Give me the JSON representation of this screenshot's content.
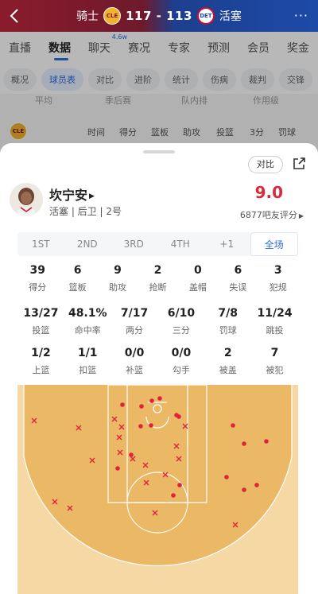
{
  "header": {
    "home_team": "骑士",
    "home_logo": "CLE",
    "score": "117 - 113",
    "away_logo": "DET",
    "away_team": "活塞"
  },
  "tabs": [
    {
      "label": "直播"
    },
    {
      "label": "数据",
      "active": true
    },
    {
      "label": "聊天",
      "badge": "4.6w"
    },
    {
      "label": "赛况"
    },
    {
      "label": "专家"
    },
    {
      "label": "预测"
    },
    {
      "label": "会员"
    },
    {
      "label": "奖金"
    }
  ],
  "subtabs": [
    {
      "label": "概况"
    },
    {
      "label": "球员表",
      "active": true
    },
    {
      "label": "对比"
    },
    {
      "label": "进阶"
    },
    {
      "label": "统计"
    },
    {
      "label": "伤病"
    },
    {
      "label": "裁判"
    },
    {
      "label": "交锋"
    }
  ],
  "background": {
    "ghost_row": [
      "平均",
      "季后赛",
      "队内排",
      "作用级"
    ],
    "team_logo": "CLE",
    "columns": [
      "时间",
      "得分",
      "篮板",
      "助攻",
      "投篮",
      "3分",
      "罚球"
    ]
  },
  "sheet": {
    "compare_label": "对比",
    "player": {
      "name": "坎宁安",
      "team_info": "活塞 | 后卫 | 2号",
      "rating": "9.0",
      "rating_label": "6877吧友评分"
    },
    "periods": [
      {
        "label": "1ST"
      },
      {
        "label": "2ND"
      },
      {
        "label": "3RD"
      },
      {
        "label": "4TH"
      },
      {
        "label": "+1"
      },
      {
        "label": "全场",
        "active": true
      }
    ],
    "stats_row1": [
      {
        "value": "39",
        "label": "得分"
      },
      {
        "value": "6",
        "label": "篮板"
      },
      {
        "value": "9",
        "label": "助攻"
      },
      {
        "value": "2",
        "label": "抢断"
      },
      {
        "value": "0",
        "label": "盖帽"
      },
      {
        "value": "6",
        "label": "失误"
      },
      {
        "value": "3",
        "label": "犯规"
      }
    ],
    "stats_row2": [
      {
        "value": "13/27",
        "label": "投篮"
      },
      {
        "value": "48.1%",
        "label": "命中率"
      },
      {
        "value": "7/17",
        "label": "两分"
      },
      {
        "value": "6/10",
        "label": "三分"
      },
      {
        "value": "7/8",
        "label": "罚球"
      },
      {
        "value": "11/24",
        "label": "跳投"
      }
    ],
    "stats_row3": [
      {
        "value": "1/2",
        "label": "上篮"
      },
      {
        "value": "1/1",
        "label": "扣篮"
      },
      {
        "value": "0/0",
        "label": "补篮"
      },
      {
        "value": "0/0",
        "label": "勾手"
      },
      {
        "value": "2",
        "label": "被盖"
      },
      {
        "value": "7",
        "label": "被犯"
      }
    ]
  },
  "colors": {
    "accent": "#2b6de5",
    "rating": "#d92b3a",
    "court_paint": "#ebb865",
    "court_outer": "#f6d8a4",
    "shot_mark": "#e0223a"
  },
  "shot_chart": {
    "made": [
      [
        24,
        8
      ],
      [
        -21,
        22
      ],
      [
        -8,
        21
      ],
      [
        -20,
        -3
      ],
      [
        -7,
        -10
      ],
      [
        95,
        21
      ],
      [
        27,
        10
      ],
      [
        -44,
        -5
      ],
      [
        3,
        -13
      ],
      [
        137,
        41
      ],
      [
        109,
        44
      ],
      [
        -33,
        58
      ],
      [
        -50,
        75
      ],
      [
        28,
        96
      ],
      [
        20,
        109
      ],
      [
        125,
        96
      ],
      [
        87,
        86
      ],
      [
        109,
        102
      ]
    ],
    "missed": [
      [
        -155,
        15
      ],
      [
        -99,
        24
      ],
      [
        -54,
        13
      ],
      [
        -45,
        23
      ],
      [
        -48,
        36
      ],
      [
        35,
        22
      ],
      [
        -47,
        55
      ],
      [
        24,
        47
      ],
      [
        -31,
        63
      ],
      [
        -15,
        71
      ],
      [
        -82,
        65
      ],
      [
        27,
        63
      ],
      [
        10,
        83
      ],
      [
        -14,
        93
      ],
      [
        -129,
        117
      ],
      [
        -110,
        125
      ],
      [
        -3,
        131
      ],
      [
        98,
        146
      ]
    ]
  }
}
